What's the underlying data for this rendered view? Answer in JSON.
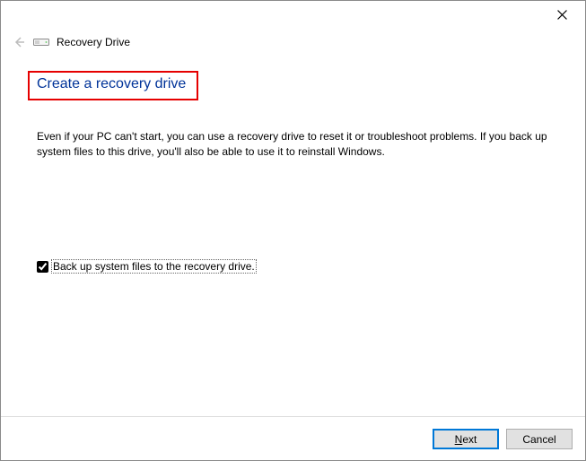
{
  "window": {
    "title": "Recovery Drive"
  },
  "heading": "Create a recovery drive",
  "description": "Even if your PC can't start, you can use a recovery drive to reset it or troubleshoot problems. If you back up system files to this drive, you'll also be able to use it to reinstall Windows.",
  "checkbox": {
    "label": "Back up system files to the recovery drive.",
    "checked": true
  },
  "buttons": {
    "next_prefix": "N",
    "next_rest": "ext",
    "cancel": "Cancel"
  }
}
